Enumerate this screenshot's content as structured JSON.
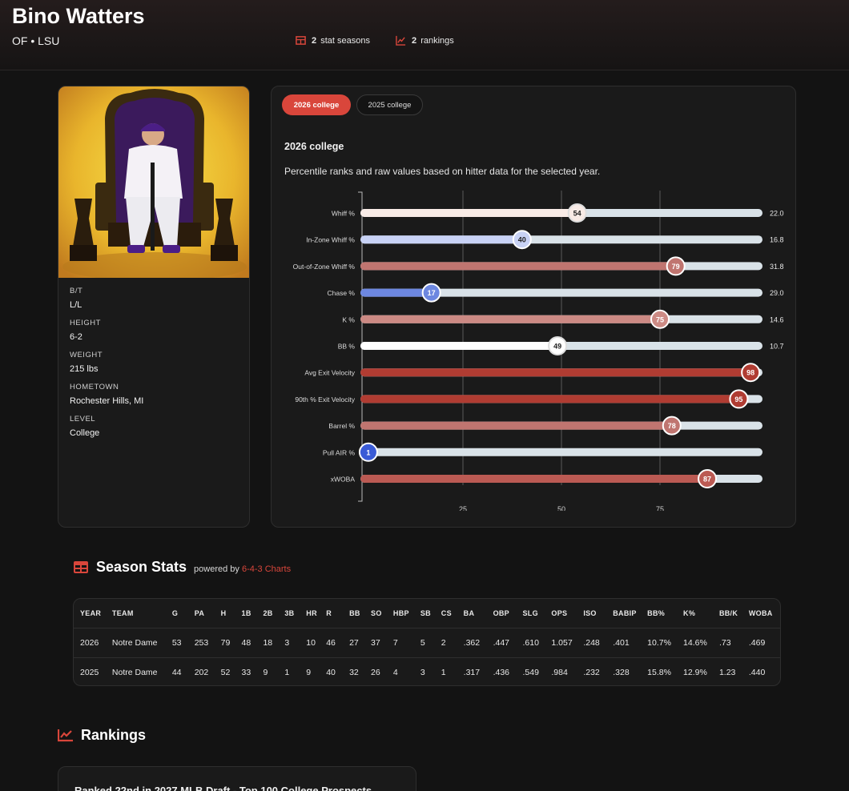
{
  "player": {
    "name": "Bino Watters",
    "subtitle": "OF • LSU"
  },
  "header_stats": [
    {
      "count": "2",
      "label": "stat seasons",
      "icon": "table-icon"
    },
    {
      "count": "2",
      "label": "rankings",
      "icon": "trend-chart-icon"
    }
  ],
  "profile": {
    "attributes": [
      {
        "label": "B/T",
        "value": "L/L"
      },
      {
        "label": "HEIGHT",
        "value": "6-2"
      },
      {
        "label": "WEIGHT",
        "value": "215 lbs"
      },
      {
        "label": "HOMETOWN",
        "value": "Rochester Hills, MI"
      },
      {
        "label": "LEVEL",
        "value": "College"
      }
    ]
  },
  "tabs": [
    {
      "label": "2026 college",
      "active": true
    },
    {
      "label": "2025 college",
      "active": false
    }
  ],
  "chart_section": {
    "title": "2026 college",
    "description": "Percentile ranks and raw values based on hitter data for the selected year."
  },
  "chart_data": {
    "type": "bar",
    "categories": [
      "Whiff %",
      "In-Zone Whiff %",
      "Out-of-Zone Whiff %",
      "Chase %",
      "K %",
      "BB %",
      "Avg Exit Velocity",
      "90th % Exit Velocity",
      "Barrel %",
      "Pull AIR %",
      "xWOBA"
    ],
    "percentiles": [
      54,
      40,
      79,
      17,
      75,
      49,
      98,
      95,
      78,
      1,
      87
    ],
    "raw_values": [
      "22.0",
      "16.8",
      "31.8",
      "29.0",
      "14.6",
      "10.7",
      "",
      "",
      "",
      "",
      ""
    ],
    "colors": [
      "#f8ebe6",
      "#c8d2f5",
      "#c07570",
      "#6d87e0",
      "#cc8a84",
      "#ffffff",
      "#b03c32",
      "#b03c32",
      "#c07570",
      "#3a5bd6",
      "#bb5a53"
    ],
    "track_color": "#d9e2e8",
    "xlim": [
      0,
      100
    ],
    "xticks": [
      25,
      50,
      75
    ],
    "grid": true
  },
  "season_stats": {
    "title": "Season Stats",
    "powered_by": "powered by",
    "powered_link": "6-4-3 Charts",
    "columns": [
      "YEAR",
      "TEAM",
      "G",
      "PA",
      "H",
      "1B",
      "2B",
      "3B",
      "HR",
      "R",
      "BB",
      "SO",
      "HBP",
      "SB",
      "CS",
      "BA",
      "OBP",
      "SLG",
      "OPS",
      "ISO",
      "BABIP",
      "BB%",
      "K%",
      "BB/K",
      "WOBA"
    ],
    "rows": [
      [
        "2026",
        "Notre Dame",
        "53",
        "253",
        "79",
        "48",
        "18",
        "3",
        "10",
        "46",
        "27",
        "37",
        "7",
        "5",
        "2",
        ".362",
        ".447",
        ".610",
        "1.057",
        ".248",
        ".401",
        "10.7%",
        "14.6%",
        ".73",
        ".469"
      ],
      [
        "2025",
        "Notre Dame",
        "44",
        "202",
        "52",
        "33",
        "9",
        "1",
        "9",
        "40",
        "32",
        "26",
        "4",
        "3",
        "1",
        ".317",
        ".436",
        ".549",
        ".984",
        ".232",
        ".328",
        "15.8%",
        "12.9%",
        "1.23",
        ".440"
      ]
    ]
  },
  "rankings": {
    "title": "Rankings",
    "items": [
      "Ranked 22nd in 2027 MLB Draft - Top 100 College Prospects"
    ]
  },
  "colors": {
    "accent": "#d9463b",
    "background": "#131313",
    "card": "#1a1a1a"
  }
}
